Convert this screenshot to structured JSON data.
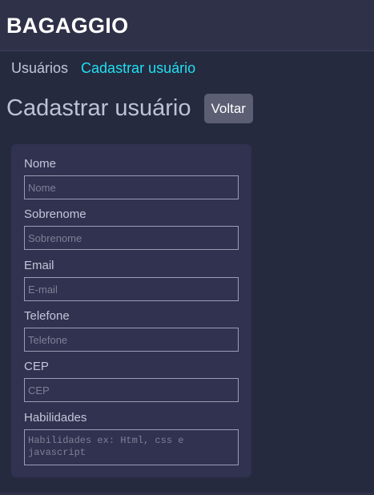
{
  "app": {
    "brand": "BAGAGGIO"
  },
  "breadcrumb": [
    {
      "label": "Usuários"
    },
    {
      "label": "Cadastrar usuário"
    }
  ],
  "page": {
    "title": "Cadastrar usuário",
    "back_label": "Voltar"
  },
  "form": {
    "nome": {
      "label": "Nome",
      "placeholder": "Nome",
      "value": ""
    },
    "sobrenome": {
      "label": "Sobrenome",
      "placeholder": "Sobrenome",
      "value": ""
    },
    "email": {
      "label": "Email",
      "placeholder": "E-mail",
      "value": ""
    },
    "telefone": {
      "label": "Telefone",
      "placeholder": "Telefone",
      "value": ""
    },
    "cep": {
      "label": "CEP",
      "placeholder": "CEP",
      "value": ""
    },
    "habilidades": {
      "label": "Habilidades",
      "placeholder": "Habilidades ex: Html, css e javascript",
      "value": ""
    }
  },
  "colors": {
    "background": "#262a3f",
    "topbar": "#2f3148",
    "accent": "#1fe0f0",
    "card": "#303250",
    "button": "#5c5f73"
  }
}
